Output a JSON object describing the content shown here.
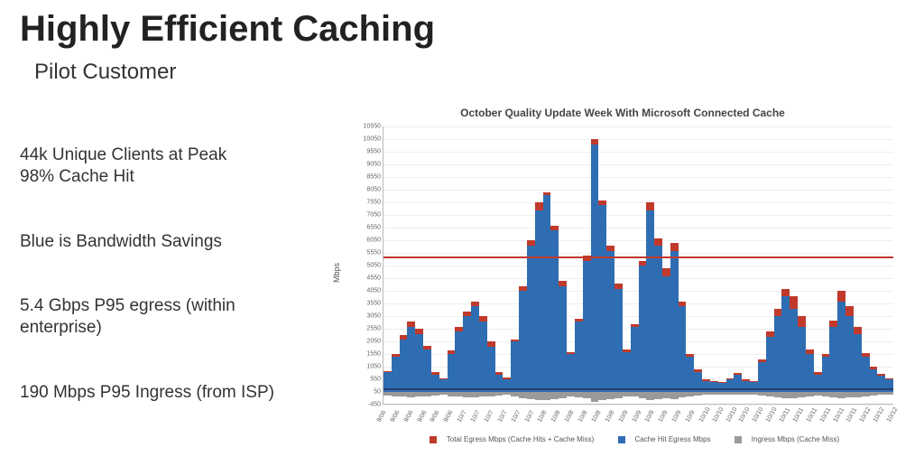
{
  "title": "Highly Efficient Caching",
  "subtitle": "Pilot Customer",
  "bullets": {
    "b1a": "44k Unique Clients at Peak",
    "b1b": "98% Cache Hit",
    "b2": "Blue is Bandwidth Savings",
    "b3": "5.4 Gbps P95 egress (within enterprise)",
    "b4": "190 Mbps P95 Ingress (from ISP)"
  },
  "chart_data": {
    "type": "area",
    "title": "October Quality Update Week With Microsoft Connected Cache",
    "ylabel": "Mbps",
    "xlabel": "",
    "ylim": [
      -450,
      10550
    ],
    "yticks": [
      -450,
      50,
      550,
      1050,
      1550,
      2050,
      2550,
      3050,
      3550,
      4050,
      4550,
      5050,
      5550,
      6050,
      6550,
      7050,
      7550,
      8050,
      8550,
      9050,
      9550,
      10050,
      10550
    ],
    "x_tick_labels": [
      "9/06",
      "9/06",
      "9/06",
      "9/06",
      "9/06",
      "9/06",
      "10/7",
      "10/7",
      "10/7",
      "10/7",
      "10/7",
      "10/7",
      "10/8",
      "10/8",
      "10/8",
      "10/8",
      "10/8",
      "10/8",
      "10/9",
      "10/9",
      "10/9",
      "10/9",
      "10/9",
      "10/9",
      "10/10",
      "10/10",
      "10/10",
      "10/10",
      "10/10",
      "10/10",
      "10/11",
      "10/11",
      "10/11",
      "10/11",
      "10/11",
      "10/11",
      "10/12",
      "10/12",
      "10/12"
    ],
    "thresholds": {
      "p95_egress": 5400,
      "p95_ingress": 190
    },
    "series": [
      {
        "name": "Total Egress Mbps (Cache Hits + Cache Miss)",
        "color": "#c0392b"
      },
      {
        "name": "Cache Hit Egress Mbps",
        "color": "#2f6db3"
      },
      {
        "name": "Ingress Mbps (Cache Miss)",
        "color": "#9a9a9a"
      }
    ],
    "legend": {
      "l1": "Total Egress Mbps (Cache Hits + Cache Miss)",
      "l2": "Cache Hit Egress Mbps",
      "l3": "Ingress Mbps (Cache Miss)"
    },
    "samples": [
      {
        "x": 0,
        "blue": 800,
        "red": 850,
        "grey": -120
      },
      {
        "x": 1,
        "blue": 1400,
        "red": 1500,
        "grey": -150
      },
      {
        "x": 2,
        "blue": 2100,
        "red": 2250,
        "grey": -180
      },
      {
        "x": 3,
        "blue": 2600,
        "red": 2800,
        "grey": -190
      },
      {
        "x": 4,
        "blue": 2300,
        "red": 2500,
        "grey": -170
      },
      {
        "x": 5,
        "blue": 1700,
        "red": 1850,
        "grey": -150
      },
      {
        "x": 6,
        "blue": 700,
        "red": 800,
        "grey": -120
      },
      {
        "x": 7,
        "blue": 500,
        "red": 550,
        "grey": -100
      },
      {
        "x": 8,
        "blue": 1500,
        "red": 1650,
        "grey": -160
      },
      {
        "x": 9,
        "blue": 2400,
        "red": 2600,
        "grey": -180
      },
      {
        "x": 10,
        "blue": 3000,
        "red": 3200,
        "grey": -190
      },
      {
        "x": 11,
        "blue": 3400,
        "red": 3600,
        "grey": -200
      },
      {
        "x": 12,
        "blue": 2800,
        "red": 3000,
        "grey": -180
      },
      {
        "x": 13,
        "blue": 1800,
        "red": 2000,
        "grey": -160
      },
      {
        "x": 14,
        "blue": 700,
        "red": 800,
        "grey": -120
      },
      {
        "x": 15,
        "blue": 500,
        "red": 600,
        "grey": -110
      },
      {
        "x": 16,
        "blue": 2000,
        "red": 2100,
        "grey": -180
      },
      {
        "x": 17,
        "blue": 4000,
        "red": 4200,
        "grey": -220
      },
      {
        "x": 18,
        "blue": 5800,
        "red": 6000,
        "grey": -260
      },
      {
        "x": 19,
        "blue": 7200,
        "red": 7500,
        "grey": -300
      },
      {
        "x": 20,
        "blue": 7800,
        "red": 7900,
        "grey": -320
      },
      {
        "x": 21,
        "blue": 6400,
        "red": 6600,
        "grey": -280
      },
      {
        "x": 22,
        "blue": 4200,
        "red": 4400,
        "grey": -230
      },
      {
        "x": 23,
        "blue": 1500,
        "red": 1600,
        "grey": -160
      },
      {
        "x": 24,
        "blue": 2800,
        "red": 2900,
        "grey": -190
      },
      {
        "x": 25,
        "blue": 5200,
        "red": 5400,
        "grey": -250
      },
      {
        "x": 26,
        "blue": 9800,
        "red": 10000,
        "grey": -380
      },
      {
        "x": 27,
        "blue": 7400,
        "red": 7600,
        "grey": -300
      },
      {
        "x": 28,
        "blue": 5600,
        "red": 5800,
        "grey": -260
      },
      {
        "x": 29,
        "blue": 4100,
        "red": 4300,
        "grey": -220
      },
      {
        "x": 30,
        "blue": 1600,
        "red": 1700,
        "grey": -160
      },
      {
        "x": 31,
        "blue": 2600,
        "red": 2700,
        "grey": -180
      },
      {
        "x": 32,
        "blue": 5000,
        "red": 5200,
        "grey": -240
      },
      {
        "x": 33,
        "blue": 7200,
        "red": 7500,
        "grey": -300
      },
      {
        "x": 34,
        "blue": 5800,
        "red": 6100,
        "grey": -270
      },
      {
        "x": 35,
        "blue": 4600,
        "red": 4900,
        "grey": -240
      },
      {
        "x": 36,
        "blue": 5600,
        "red": 5900,
        "grey": -260
      },
      {
        "x": 37,
        "blue": 3400,
        "red": 3600,
        "grey": -210
      },
      {
        "x": 38,
        "blue": 1400,
        "red": 1500,
        "grey": -150
      },
      {
        "x": 39,
        "blue": 800,
        "red": 900,
        "grey": -120
      },
      {
        "x": 40,
        "blue": 450,
        "red": 520,
        "grey": -100
      },
      {
        "x": 41,
        "blue": 400,
        "red": 450,
        "grey": -90
      },
      {
        "x": 42,
        "blue": 380,
        "red": 420,
        "grey": -85
      },
      {
        "x": 43,
        "blue": 500,
        "red": 550,
        "grey": -95
      },
      {
        "x": 44,
        "blue": 700,
        "red": 770,
        "grey": -110
      },
      {
        "x": 45,
        "blue": 450,
        "red": 500,
        "grey": -95
      },
      {
        "x": 46,
        "blue": 400,
        "red": 440,
        "grey": -90
      },
      {
        "x": 47,
        "blue": 1200,
        "red": 1300,
        "grey": -140
      },
      {
        "x": 48,
        "blue": 2200,
        "red": 2400,
        "grey": -180
      },
      {
        "x": 49,
        "blue": 3000,
        "red": 3300,
        "grey": -210
      },
      {
        "x": 50,
        "blue": 3800,
        "red": 4100,
        "grey": -230
      },
      {
        "x": 51,
        "blue": 3300,
        "red": 3800,
        "grey": -230
      },
      {
        "x": 52,
        "blue": 2600,
        "red": 3000,
        "grey": -200
      },
      {
        "x": 53,
        "blue": 1500,
        "red": 1700,
        "grey": -160
      },
      {
        "x": 54,
        "blue": 700,
        "red": 800,
        "grey": -120
      },
      {
        "x": 55,
        "blue": 1400,
        "red": 1500,
        "grey": -150
      },
      {
        "x": 56,
        "blue": 2600,
        "red": 2850,
        "grey": -190
      },
      {
        "x": 57,
        "blue": 3600,
        "red": 4000,
        "grey": -230
      },
      {
        "x": 58,
        "blue": 3000,
        "red": 3400,
        "grey": -210
      },
      {
        "x": 59,
        "blue": 2300,
        "red": 2600,
        "grey": -190
      },
      {
        "x": 60,
        "blue": 1400,
        "red": 1550,
        "grey": -160
      },
      {
        "x": 61,
        "blue": 900,
        "red": 1000,
        "grey": -130
      },
      {
        "x": 62,
        "blue": 650,
        "red": 720,
        "grey": -110
      },
      {
        "x": 63,
        "blue": 500,
        "red": 560,
        "grey": -100
      }
    ]
  }
}
